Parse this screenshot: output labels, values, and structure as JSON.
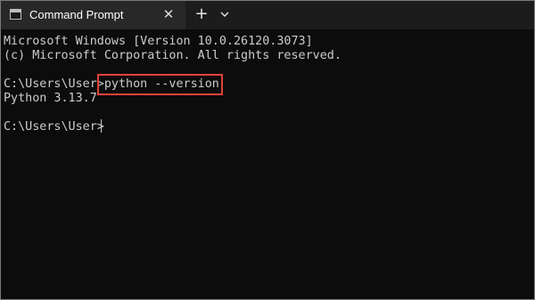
{
  "tab": {
    "title": "Command Prompt",
    "icon": "command-prompt-icon",
    "close_icon": "close-icon"
  },
  "toolbar": {
    "new_tab_icon": "plus-icon",
    "dropdown_icon": "chevron-down-icon"
  },
  "console": {
    "lines": [
      "Microsoft Windows [Version 10.0.26120.3073]",
      "(c) Microsoft Corporation. All rights reserved.",
      "",
      "C:\\Users\\User>python --version",
      "Python 3.13.7",
      "",
      "C:\\Users\\User>"
    ],
    "highlighted_command": "python --version"
  },
  "colors": {
    "background": "#0c0c0c",
    "text": "#cccccc",
    "highlight": "#e2433a"
  }
}
